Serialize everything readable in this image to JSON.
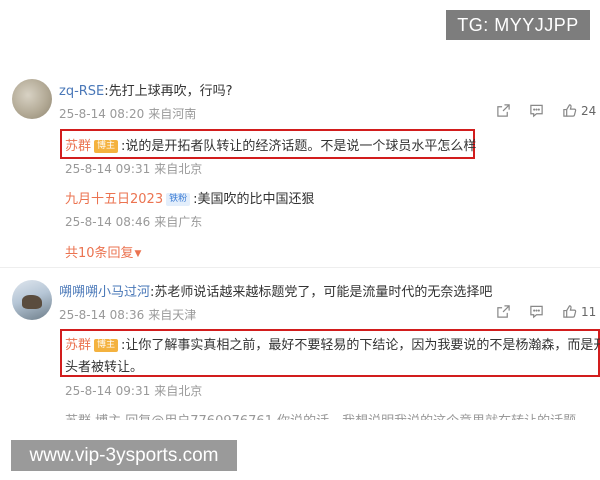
{
  "watermarks": {
    "top": "TG: MYYJJPP",
    "bottom": "www.vip-3ysports.com"
  },
  "comment1": {
    "author": "zq-RSE",
    "text": ":先打上球再吹，行吗?",
    "time": "25-8-14 08:20",
    "source": "来自河南",
    "likes": "24"
  },
  "reply1": {
    "author": "苏群",
    "badge": "博主",
    "text": ":说的是开拓者队转让的经济话题。不是说一个球员水平怎么样",
    "time": "25-8-14 09:31",
    "source": "来自北京"
  },
  "reply2": {
    "author": "九月十五日2023",
    "badge": "铁粉",
    "text": ":美国吹的比中国还狠",
    "time": "25-8-14 08:46",
    "source": "来自广东"
  },
  "more_replies": "共10条回复",
  "comment2": {
    "author": "嗍嗍嗍小马过河",
    "text": ":苏老师说话越来越标题党了，可能是流量时代的无奈选择吧",
    "time": "25-8-14 08:36",
    "source": "来自天津",
    "likes": "11"
  },
  "reply3": {
    "author": "苏群",
    "badge": "博主",
    "text_line1": ":让你了解事实真相之前，最好不要轻易的下结论，因为我要说的不是杨瀚森，而是开",
    "text_line2": "头者被转让。",
    "time": "25-8-14 09:31",
    "source": "来自北京"
  },
  "cut_off": "苏群 博主 回复@用户7760976761 你说的话，我想说明我说的这个意思就在转让的话题"
}
